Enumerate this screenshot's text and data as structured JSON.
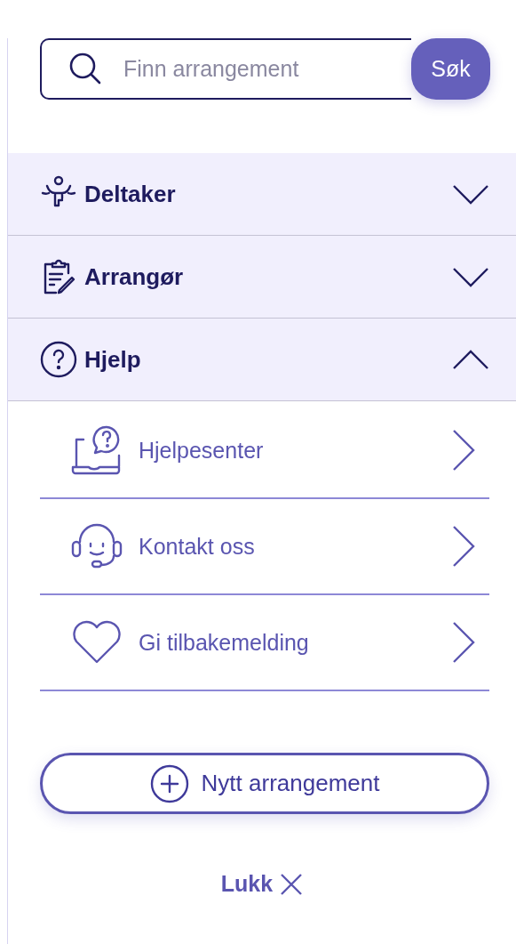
{
  "search": {
    "placeholder": "Finn arrangement",
    "button": "Søk"
  },
  "sections": [
    {
      "label": "Deltaker",
      "kind": "person",
      "expanded": false
    },
    {
      "label": "Arrangør",
      "kind": "clipboard",
      "expanded": false
    },
    {
      "label": "Hjelp",
      "kind": "help",
      "expanded": true,
      "children": [
        {
          "label": "Hjelpesenter",
          "kind": "laptop-help"
        },
        {
          "label": "Kontakt oss",
          "kind": "headset"
        },
        {
          "label": "Gi tilbakemelding",
          "kind": "heart"
        }
      ]
    }
  ],
  "new_button": "Nytt arrangement",
  "close_label": "Lukk"
}
